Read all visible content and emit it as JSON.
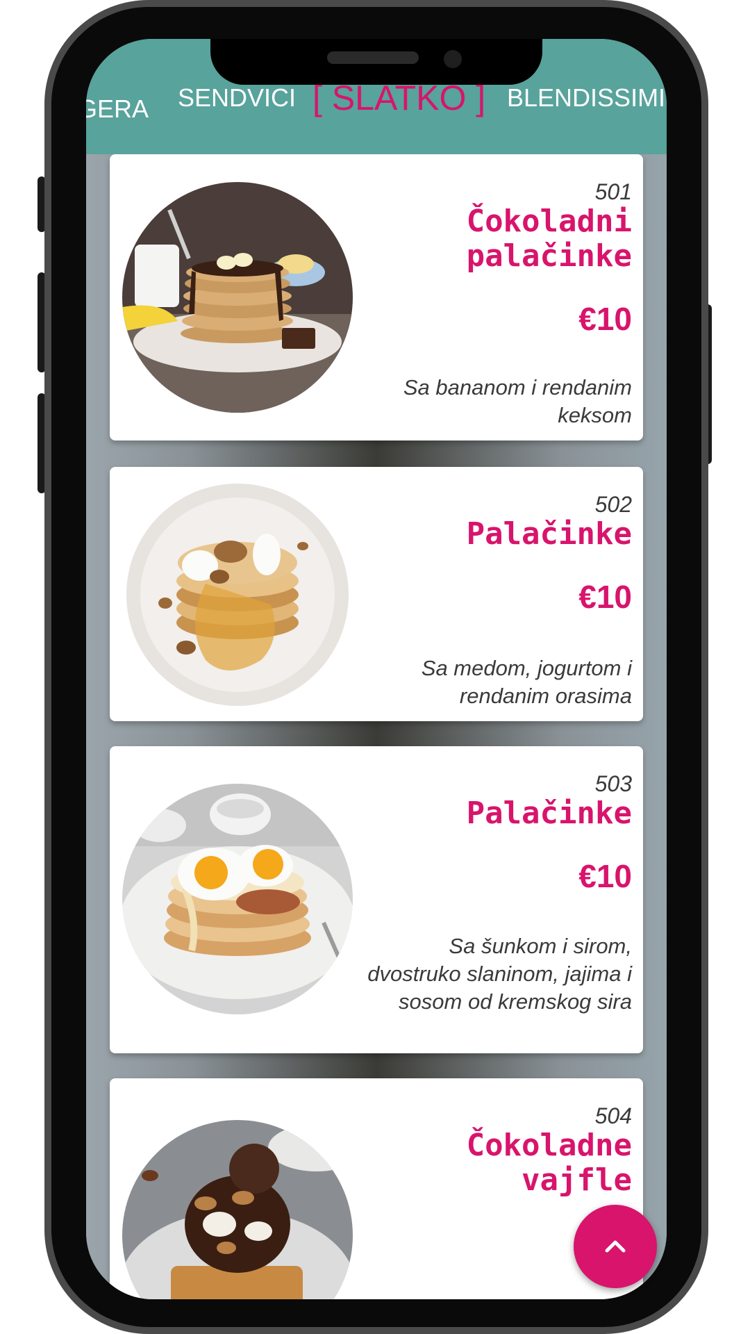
{
  "categories": [
    {
      "label": "GERA",
      "active": false
    },
    {
      "label": "SENDVICI",
      "active": false
    },
    {
      "label": "[ SLATKO ]",
      "active": true
    },
    {
      "label": "BLENDISSIMI",
      "active": false
    }
  ],
  "items": [
    {
      "number": "501",
      "name_line1": "Čokoladni",
      "name_line2": "palačinke",
      "price": "€10",
      "description": "Sa bananom i rendanim keksom"
    },
    {
      "number": "502",
      "name_line1": "Palačinke",
      "price": "€10",
      "description": "Sa medom, jogurtom i rendanim orasima"
    },
    {
      "number": "503",
      "name_line1": "Palačinke",
      "price": "€10",
      "description": "Sa šunkom i sirom, dvostruko slaninom, jajima i sosom od kremskog sira"
    },
    {
      "number": "504",
      "name_line1": "Čokoladne",
      "name_line2": "vajfle"
    }
  ],
  "fab": {
    "icon": "chevron-up-icon"
  },
  "colors": {
    "accent": "#d8146c",
    "header": "#58a39c"
  }
}
